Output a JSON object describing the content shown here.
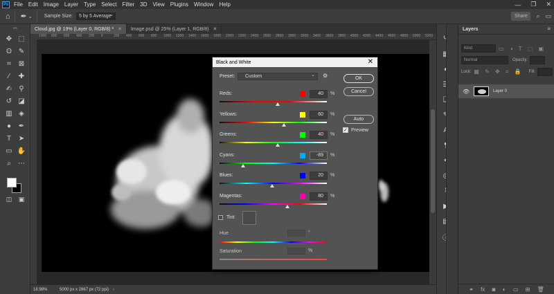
{
  "app": {
    "logo_text": "Ps"
  },
  "menu": [
    "File",
    "Edit",
    "Image",
    "Layer",
    "Type",
    "Select",
    "Filter",
    "3D",
    "View",
    "Plugins",
    "Window",
    "Help"
  ],
  "window_controls": [
    "—",
    "❐",
    "✕"
  ],
  "options_bar": {
    "sample_size_label": "Sample Size:",
    "sample_size_value": "5 by 5 Average",
    "share_label": "Share"
  },
  "tabs": [
    {
      "label": "Cloud.jpg @ 19% (Layer 0, RGB/8) *",
      "active": true
    },
    {
      "label": "Image.psd @ 25% (Layer 1, RGB/8)",
      "active": false
    }
  ],
  "ruler_numbers": [
    "1000",
    "800",
    "600",
    "400",
    "200",
    "0",
    "200",
    "400",
    "600",
    "800",
    "1000",
    "1200",
    "1400",
    "1600",
    "1800",
    "2000",
    "2200",
    "2400",
    "2600",
    "2800",
    "3000",
    "3200",
    "3400",
    "3600",
    "3800",
    "4000",
    "4200",
    "4400",
    "4600",
    "4800",
    "5000",
    "5200"
  ],
  "status": {
    "zoom": "18.98%",
    "doc_info": "5000 px x 2867 px (72 ppi)"
  },
  "layers_panel": {
    "title": "Layers",
    "kind_filter": "Kind",
    "blend_mode": "Normal",
    "opacity_label": "Opacity:",
    "lock_label": "Lock:",
    "fill_label": "Fill:",
    "layers": [
      {
        "name": "Layer 0",
        "visible": true
      }
    ]
  },
  "dialog": {
    "title": "Black and White",
    "preset_label": "Preset:",
    "preset_value": "Custom",
    "ok_label": "OK",
    "cancel_label": "Cancel",
    "auto_label": "Auto",
    "preview_label": "Preview",
    "preview_checked": true,
    "percent_unit": "%",
    "degree_unit": "°",
    "sliders": [
      {
        "label": "Reds:",
        "value": "40",
        "swatch": "#ff0000",
        "position": 0.54,
        "gradient": [
          "#ff0000",
          "#ff0000"
        ]
      },
      {
        "label": "Yellows:",
        "value": "60",
        "swatch": "#ffff00",
        "position": 0.6,
        "gradient": [
          "#ff0000",
          "#ffff00",
          "#00ff00"
        ]
      },
      {
        "label": "Greens:",
        "value": "40",
        "swatch": "#00ff00",
        "position": 0.54,
        "gradient": [
          "#ffff00",
          "#00ff00",
          "#00ffff"
        ]
      },
      {
        "label": "Cyans:",
        "value": "-89",
        "swatch": "#00aaff",
        "position": 0.22,
        "gradient": [
          "#00ff00",
          "#00ffff",
          "#0000ff"
        ]
      },
      {
        "label": "Blues:",
        "value": "20",
        "swatch": "#0000ff",
        "position": 0.49,
        "gradient": [
          "#00ffff",
          "#0000ff",
          "#ff00ff"
        ]
      },
      {
        "label": "Magentas:",
        "value": "80",
        "swatch": "#ff00aa",
        "position": 0.63,
        "gradient": [
          "#0000ff",
          "#ff00ff",
          "#ff0000"
        ]
      }
    ],
    "tint_label": "Tint",
    "tint_checked": false,
    "hue_label": "Hue",
    "saturation_label": "Saturation"
  }
}
